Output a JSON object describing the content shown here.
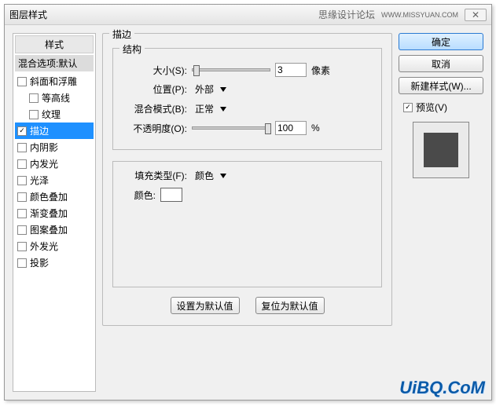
{
  "titlebar": {
    "title": "图层样式",
    "brand": "思缘设计论坛",
    "url": "WWW.MISSYUAN.COM",
    "close": "✕"
  },
  "styles": {
    "header": "样式",
    "blend": "混合选项:默认",
    "items": [
      {
        "label": "斜面和浮雕",
        "checked": false,
        "indent": false
      },
      {
        "label": "等高线",
        "checked": false,
        "indent": true
      },
      {
        "label": "纹理",
        "checked": false,
        "indent": true
      },
      {
        "label": "描边",
        "checked": true,
        "indent": false,
        "selected": true
      },
      {
        "label": "内阴影",
        "checked": false,
        "indent": false
      },
      {
        "label": "内发光",
        "checked": false,
        "indent": false
      },
      {
        "label": "光泽",
        "checked": false,
        "indent": false
      },
      {
        "label": "颜色叠加",
        "checked": false,
        "indent": false
      },
      {
        "label": "渐变叠加",
        "checked": false,
        "indent": false
      },
      {
        "label": "图案叠加",
        "checked": false,
        "indent": false
      },
      {
        "label": "外发光",
        "checked": false,
        "indent": false
      },
      {
        "label": "投影",
        "checked": false,
        "indent": false
      }
    ]
  },
  "stroke": {
    "panel_title": "描边",
    "structure_title": "结构",
    "size_label": "大小(S):",
    "size_value": "3",
    "size_unit": "像素",
    "position_label": "位置(P):",
    "position_value": "外部",
    "blendmode_label": "混合模式(B):",
    "blendmode_value": "正常",
    "opacity_label": "不透明度(O):",
    "opacity_value": "100",
    "opacity_unit": "%",
    "filltype_label": "填充类型(F):",
    "filltype_value": "颜色",
    "color_label": "颜色:",
    "set_default": "设置为默认值",
    "reset_default": "复位为默认值"
  },
  "side": {
    "ok": "确定",
    "cancel": "取消",
    "newstyle": "新建样式(W)...",
    "preview_label": "预览(V)",
    "preview_checked": true
  },
  "watermark": "UiBQ.CoM"
}
